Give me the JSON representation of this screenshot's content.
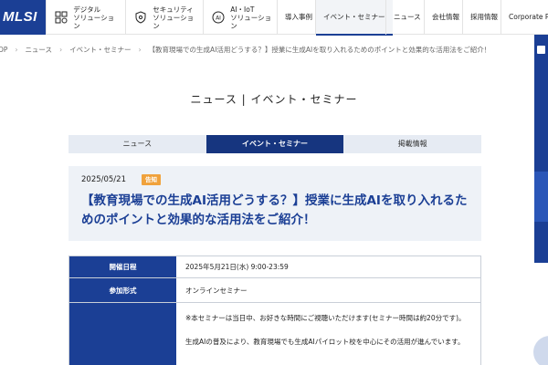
{
  "header": {
    "logo": "MLSI",
    "solutions": [
      {
        "label": "デジタル\nソリューション",
        "icon": "gear-grid-icon"
      },
      {
        "label": "セキュリティ\nソリューション",
        "icon": "shield-icon"
      },
      {
        "label": "AI・IoT\nソリューション",
        "icon": "ai-chip-icon"
      }
    ],
    "nav": [
      "導入事例",
      "イベント・セミナー",
      "ニュース",
      "会社情報",
      "採用情報",
      "Corporate Pro"
    ]
  },
  "breadcrumb": [
    "OP",
    "ニュース",
    "イベント・セミナー",
    "【教育現場での生成AI活用どうする？】授業に生成AIを取り入れるためのポイントと効果的な活用法をご紹介！"
  ],
  "page_title": "ニュース | イベント・セミナー",
  "tabs": [
    "ニュース",
    "イベント・セミナー",
    "掲載情報"
  ],
  "article": {
    "date": "2025/05/21",
    "badge": "告知",
    "headline": "【教育現場での生成AI活用どうする？】授業に生成AIを取り入れるためのポイントと効果的な活用法をご紹介！"
  },
  "table": {
    "rows": [
      {
        "key": "開催日程",
        "value": "2025年5月21日(水) 9:00-23:59"
      },
      {
        "key": "参加形式",
        "value": "オンラインセミナー"
      },
      {
        "key": "",
        "value_lines": [
          "※本セミナーは当日中、お好きな時間にご視聴いただけます(セミナー時間は約20分です)。",
          "生成AIの普及により、教育現場でも生成AIパイロット校を中心にその活用が進んでいます。"
        ]
      }
    ]
  },
  "colors": {
    "brand": "#1b3f95",
    "badge": "#f0a23c",
    "panel": "#eef2f7"
  }
}
